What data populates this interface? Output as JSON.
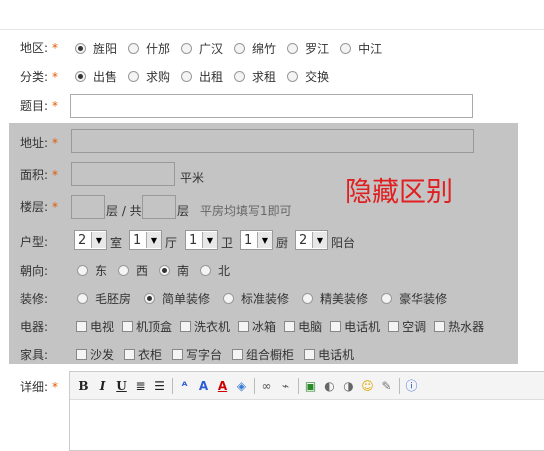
{
  "district": {
    "label": "地区:",
    "options": [
      "旌阳",
      "什邡",
      "广汉",
      "绵竹",
      "罗江",
      "中江"
    ],
    "selected": 0
  },
  "category": {
    "label": "分类:",
    "options": [
      "出售",
      "求购",
      "出租",
      "求租",
      "交换"
    ],
    "selected": 0
  },
  "subject": {
    "label": "题目:"
  },
  "required_mark": "*",
  "hidden_title": "隐藏区别",
  "address": {
    "label": "地址:"
  },
  "area": {
    "label": "面积:",
    "unit": "平米"
  },
  "floor": {
    "label": "楼层:",
    "floor_unit": "层 / 共",
    "total_unit": "层",
    "hint": "平房均填写1即可"
  },
  "layout": {
    "label": "户型:",
    "rooms": {
      "value": "2",
      "unit": "室"
    },
    "halls": {
      "value": "1",
      "unit": "厅"
    },
    "baths": {
      "value": "1",
      "unit": "卫"
    },
    "kitchens": {
      "value": "1",
      "unit": "厨"
    },
    "balconies": {
      "value": "2",
      "unit": "阳台"
    }
  },
  "orientation": {
    "label": "朝向:",
    "options": [
      "东",
      "西",
      "南",
      "北"
    ],
    "selected": 2
  },
  "decoration": {
    "label": "装修:",
    "options": [
      "毛胚房",
      "简单装修",
      "标准装修",
      "精美装修",
      "豪华装修"
    ],
    "selected": 1
  },
  "appliances": {
    "label": "电器:",
    "options": [
      "电视",
      "机顶盒",
      "洗衣机",
      "冰箱",
      "电脑",
      "电话机",
      "空调",
      "热水器"
    ]
  },
  "furniture": {
    "label": "家具:",
    "options": [
      "沙发",
      "衣柜",
      "写字台",
      "组合橱柜",
      "电话机"
    ]
  },
  "details": {
    "label": "详细:"
  },
  "toolbar": {
    "bold": "B",
    "italic": "I",
    "underline": "U"
  },
  "colors": {
    "panel": "#c4c4c4",
    "required": "#e05a00",
    "hidden_title": "#e02020"
  }
}
